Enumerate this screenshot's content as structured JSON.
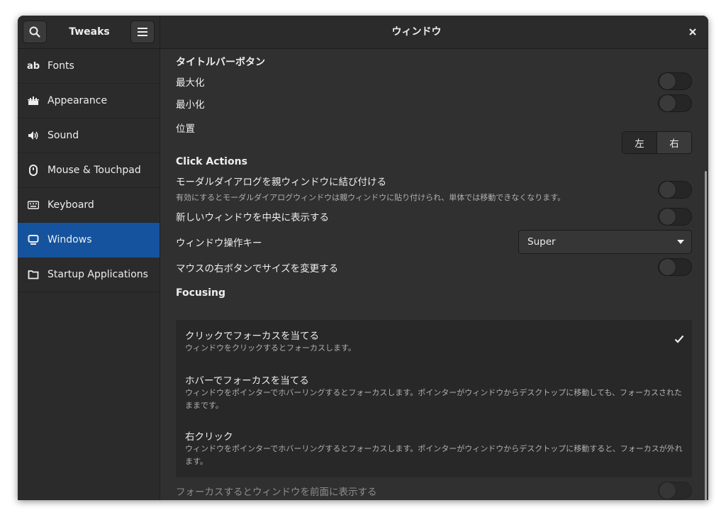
{
  "header": {
    "app_title": "Tweaks",
    "page_title": "ウィンドウ",
    "search_icon": "search-icon",
    "menu_icon": "hamburger-menu-icon",
    "close_icon": "close-icon"
  },
  "sidebar": {
    "items": [
      {
        "label": "Fonts",
        "icon_text": "ab",
        "icon": "fonts-icon"
      },
      {
        "label": "Appearance",
        "icon": "appearance-icon"
      },
      {
        "label": "Sound",
        "icon": "speaker-icon"
      },
      {
        "label": "Mouse & Touchpad",
        "icon": "mouse-icon"
      },
      {
        "label": "Keyboard",
        "icon": "keyboard-icon"
      },
      {
        "label": "Windows",
        "icon": "window-icon",
        "active": true
      },
      {
        "label": "Startup Applications",
        "icon": "folder-icon"
      }
    ]
  },
  "titlebar_buttons": {
    "section_title": "タイトルバーボタン",
    "maximize_label": "最大化",
    "maximize_on": false,
    "minimize_label": "最小化",
    "minimize_on": false,
    "placement_label": "位置",
    "placement_left": "左",
    "placement_right": "右",
    "placement_selected": "右"
  },
  "click_actions": {
    "section_title": "Click Actions",
    "attach_modal_label": "モーダルダイアログを親ウィンドウに結び付ける",
    "attach_modal_desc": "有効にするとモーダルダイアログウィンドウは親ウィンドウに貼り付けられ、単体では移動できなくなります。",
    "attach_modal_on": false,
    "center_new_label": "新しいウィンドウを中央に表示する",
    "center_new_on": false,
    "action_key_label": "ウィンドウ操作キー",
    "action_key_value": "Super",
    "resize_secondary_label": "マウスの右ボタンでサイズを変更する",
    "resize_secondary_on": false
  },
  "focusing": {
    "section_title": "Focusing",
    "options": [
      {
        "title": "クリックでフォーカスを当てる",
        "desc": "ウィンドウをクリックするとフォーカスします。",
        "selected": true
      },
      {
        "title": "ホバーでフォーカスを当てる",
        "desc": "ウィンドウをポインターでホバーリングするとフォーカスします。ポインターがウィンドウからデスクトップに移動しても、フォーカスされたままです。",
        "selected": false
      },
      {
        "title": "右クリック",
        "desc": "ウィンドウをポインターでホバーリングするとフォーカスします。ポインターがウィンドウからデスクトップに移動すると、フォーカスが外れます。",
        "selected": false
      }
    ],
    "raise_label": "フォーカスするとウィンドウを前面に表示する",
    "raise_on": false
  },
  "colors": {
    "accent": "#15539e",
    "background": "#303030",
    "sidebar": "#2b2b2b"
  }
}
